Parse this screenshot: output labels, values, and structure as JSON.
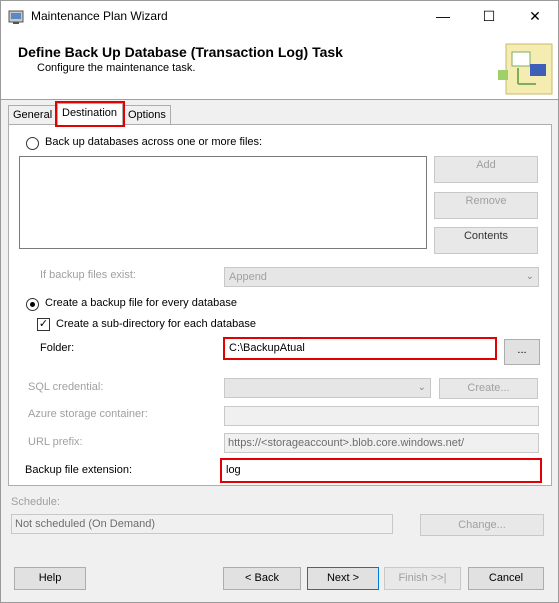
{
  "window": {
    "title": "Maintenance Plan Wizard",
    "minimize": "—",
    "maximize": "☐",
    "close": "✕"
  },
  "header": {
    "title": "Define Back Up Database (Transaction Log) Task",
    "subtitle": "Configure the maintenance task."
  },
  "tabs": [
    {
      "label": "General"
    },
    {
      "label": "Destination"
    },
    {
      "label": "Options"
    }
  ],
  "destination": {
    "backup_across_files_label": "Back up databases across one or more files:",
    "add_button": "Add",
    "remove_button": "Remove",
    "contents_button": "Contents",
    "if_exist_label": "If backup files exist:",
    "if_exist_value": "Append",
    "create_per_db_label": "Create a backup file for every database",
    "create_subdir_label": "Create a sub-directory for each database",
    "folder_label": "Folder:",
    "folder_value": "C:\\BackupAtual",
    "browse_button": "...",
    "sql_credential_label": "SQL credential:",
    "create_button": "Create...",
    "azure_container_label": "Azure storage container:",
    "url_prefix_label": "URL prefix:",
    "url_prefix_value": "https://<storageaccount>.blob.core.windows.net/",
    "extension_label": "Backup file extension:",
    "extension_value": "log"
  },
  "schedule": {
    "label": "Schedule:",
    "value": "Not scheduled (On Demand)",
    "change_button": "Change..."
  },
  "footer": {
    "help": "Help",
    "back": "< Back",
    "next": "Next >",
    "finish": "Finish >>|",
    "cancel": "Cancel"
  }
}
